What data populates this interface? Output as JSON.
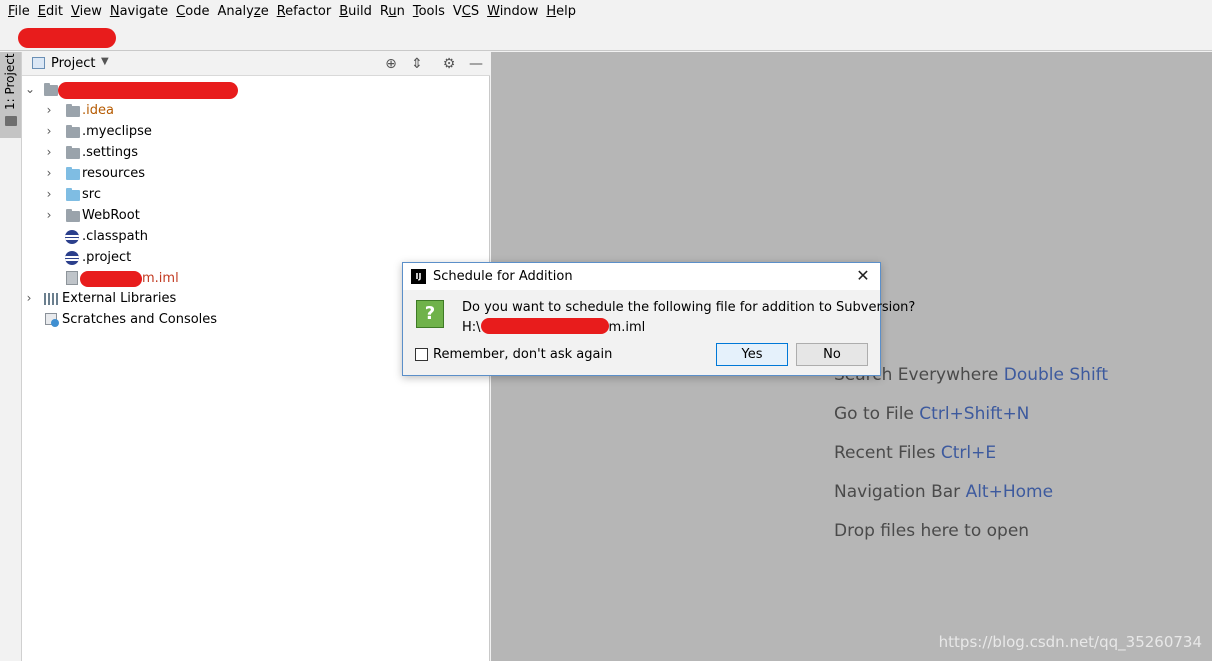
{
  "menu": [
    {
      "label": "File",
      "mnemonic_index": 0
    },
    {
      "label": "Edit",
      "mnemonic_index": 0
    },
    {
      "label": "View",
      "mnemonic_index": 0
    },
    {
      "label": "Navigate",
      "mnemonic_index": 0
    },
    {
      "label": "Code",
      "mnemonic_index": 0
    },
    {
      "label": "Analyze",
      "mnemonic_index": 5
    },
    {
      "label": "Refactor",
      "mnemonic_index": 0
    },
    {
      "label": "Build",
      "mnemonic_index": 0
    },
    {
      "label": "Run",
      "mnemonic_index": 1
    },
    {
      "label": "Tools",
      "mnemonic_index": 0
    },
    {
      "label": "VCS",
      "mnemonic_index": 1
    },
    {
      "label": "Window",
      "mnemonic_index": 0
    },
    {
      "label": "Help",
      "mnemonic_index": 0
    }
  ],
  "tool_stripe": {
    "label": "1: Project"
  },
  "project_panel": {
    "title": "Project",
    "tree": [
      {
        "label": ".idea",
        "icon": "folder-icon",
        "expandable": true,
        "color": "orange"
      },
      {
        "label": ".myeclipse",
        "icon": "folder-icon",
        "expandable": true
      },
      {
        "label": ".settings",
        "icon": "folder-icon",
        "expandable": true
      },
      {
        "label": "resources",
        "icon": "folder-icon",
        "expandable": true,
        "blue": true
      },
      {
        "label": "src",
        "icon": "folder-icon",
        "expandable": true,
        "blue": true
      },
      {
        "label": "WebRoot",
        "icon": "folder-icon",
        "expandable": true
      },
      {
        "label": ".classpath",
        "icon": "eclipse-icon",
        "expandable": false
      },
      {
        "label": ".project",
        "icon": "eclipse-icon",
        "expandable": false
      },
      {
        "label": "m.iml",
        "icon": "file-icon",
        "expandable": false,
        "color": "red"
      }
    ],
    "external_libraries": "External Libraries",
    "scratches": "Scratches and Consoles"
  },
  "editor_hints": [
    {
      "text": "Search Everywhere",
      "shortcut": "Double Shift"
    },
    {
      "text": "Go to File",
      "shortcut": "Ctrl+Shift+N"
    },
    {
      "text": "Recent Files",
      "shortcut": "Ctrl+E"
    },
    {
      "text": "Navigation Bar",
      "shortcut": "Alt+Home"
    },
    {
      "text": "Drop files here to open",
      "shortcut": ""
    }
  ],
  "watermark": "https://blog.csdn.net/qq_35260734",
  "dialog": {
    "logo": "IJ",
    "title": "Schedule for Addition",
    "message": "Do you want to schedule the following file for addition to Subversion?",
    "path_prefix": "H:\\",
    "path_suffix": "m.iml",
    "checkbox_label": "Remember, don't ask again",
    "yes_label": "Yes",
    "no_label": "No"
  },
  "colors": {
    "accent": "#0078d7",
    "shortcut": "#3d5a9e",
    "redaction": "#e81c1c"
  }
}
